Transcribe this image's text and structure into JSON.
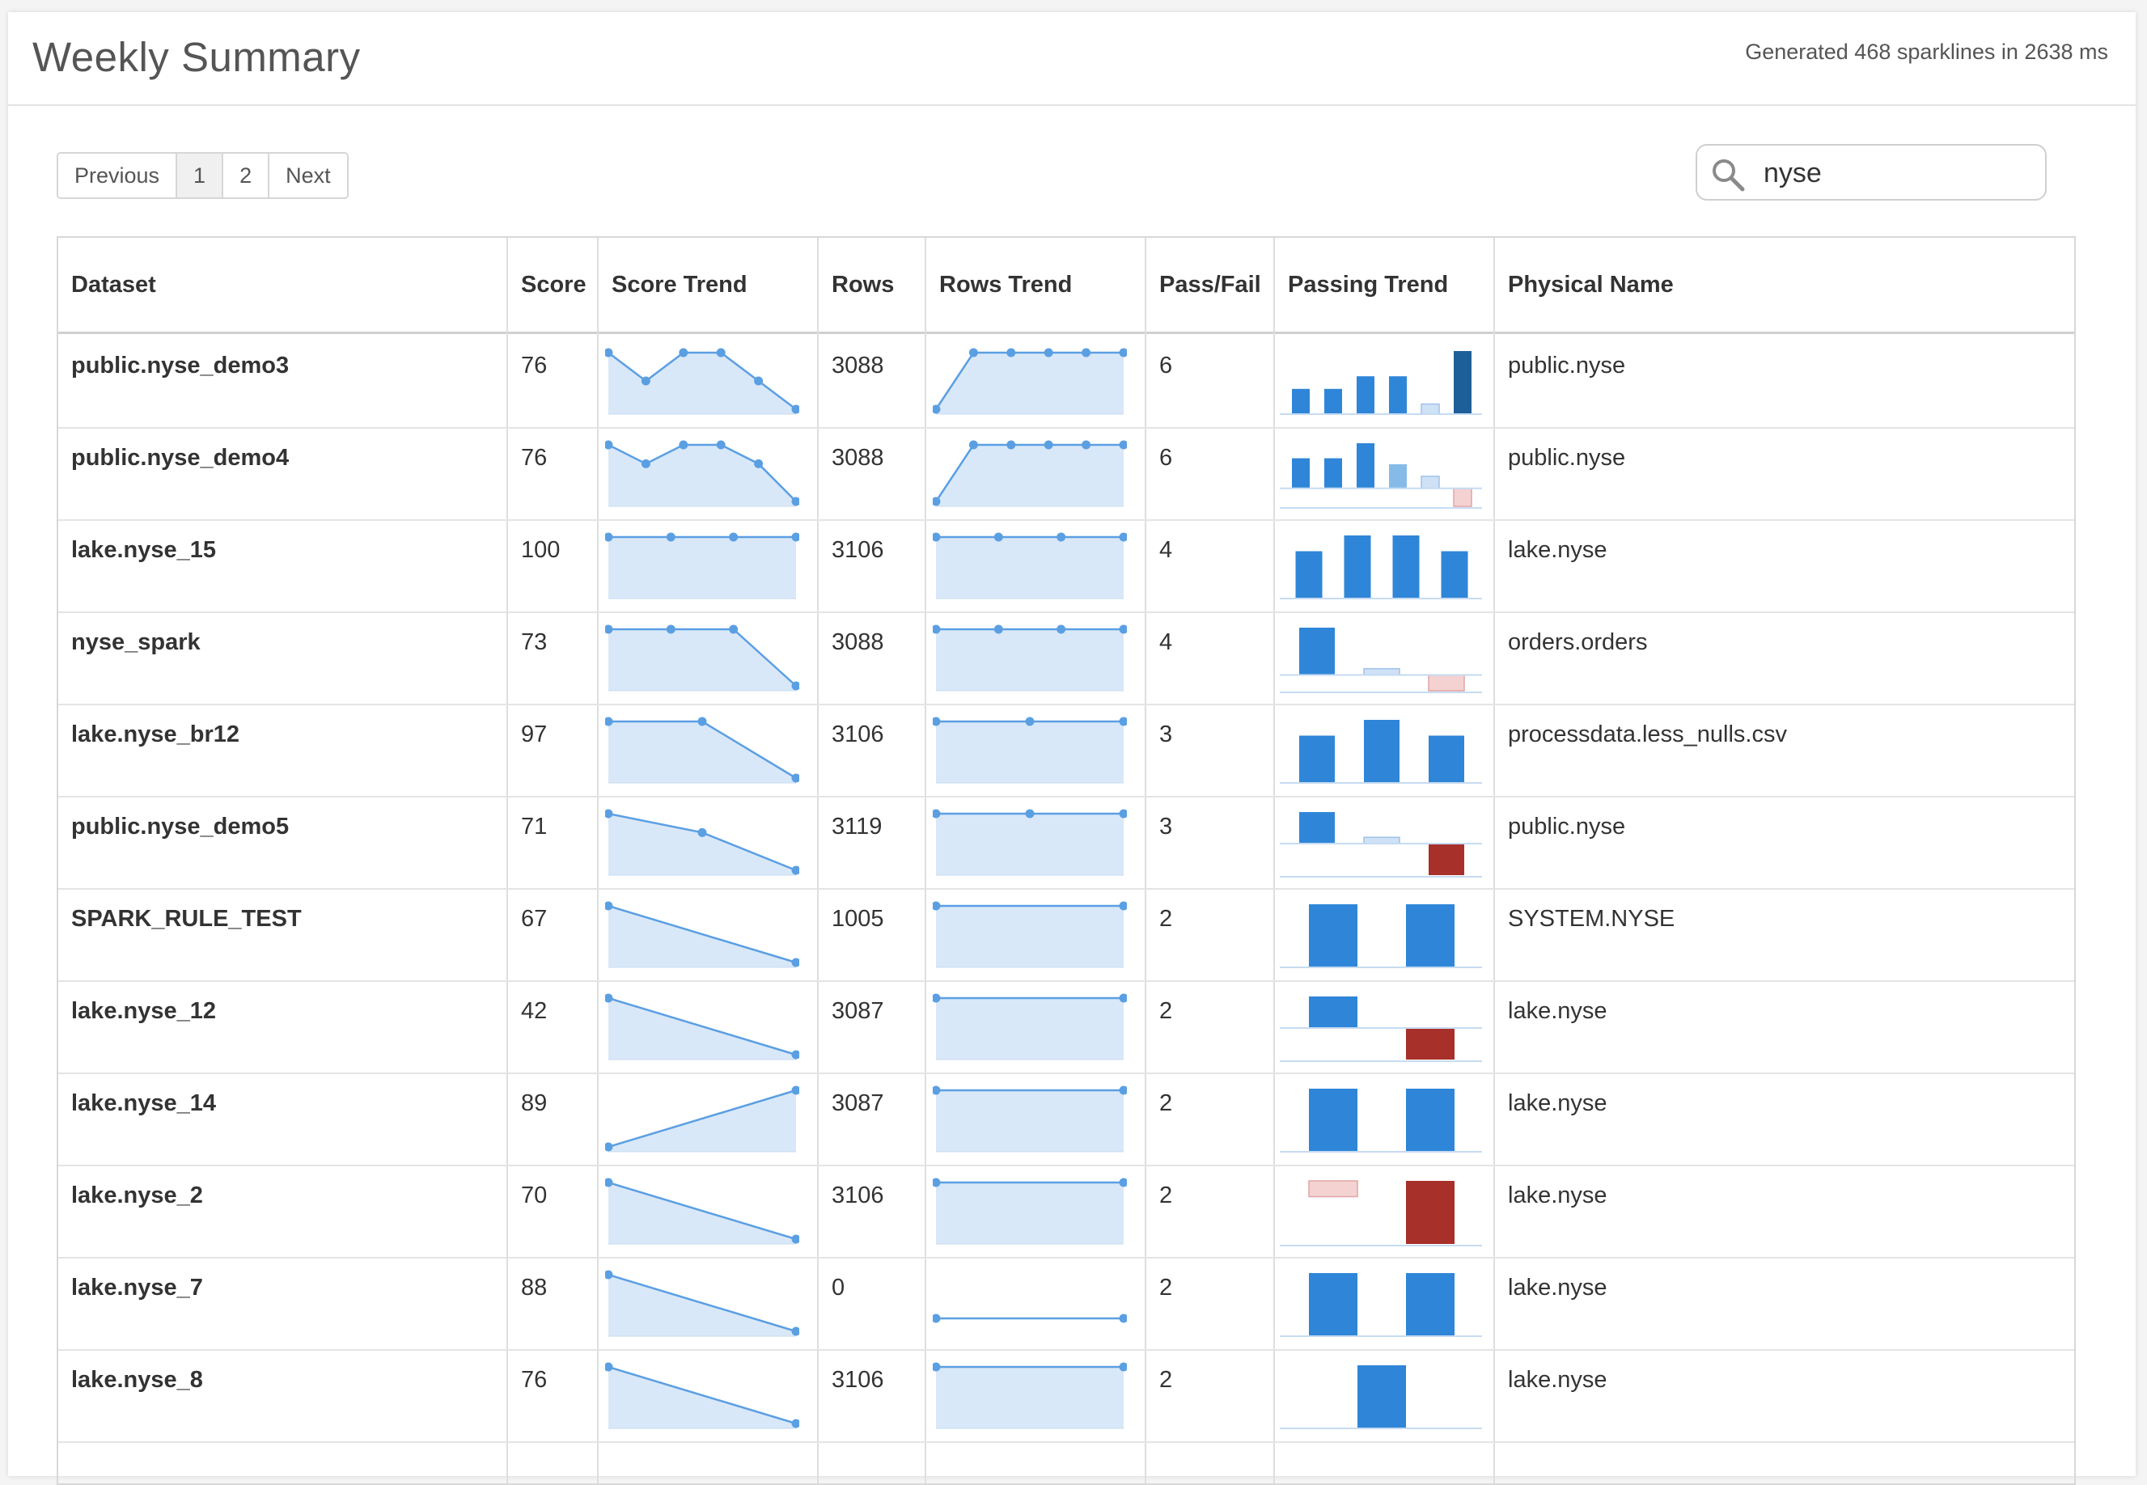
{
  "header": {
    "title": "Weekly Summary",
    "generated": "Generated 468 sparklines in 2638 ms"
  },
  "pagination": {
    "previous": "Previous",
    "pages": [
      "1",
      "2"
    ],
    "next": "Next",
    "active_page": "1"
  },
  "search": {
    "value": "nyse",
    "icon": "search-icon"
  },
  "table": {
    "columns": [
      "Dataset",
      "Score",
      "Score Trend",
      "Rows",
      "Rows Trend",
      "Pass/Fail",
      "Passing Trend",
      "Physical Name"
    ],
    "rows": [
      {
        "dataset": "public.nyse_demo3",
        "score": "76",
        "score_trend": [
          78,
          76,
          78,
          78,
          76,
          74
        ],
        "rows": "3088",
        "rows_trend": [
          0,
          3088,
          3088,
          3088,
          3088,
          3088
        ],
        "pass_fail": "6",
        "passing_trend": [
          2,
          2,
          3,
          3,
          0.8,
          5
        ],
        "passing_colors": [
          "#2f86d8",
          "#2f86d8",
          "#2f86d8",
          "#2f86d8",
          "#cfe1f5",
          "#1f5f99"
        ],
        "physical_name": "public.nyse"
      },
      {
        "dataset": "public.nyse_demo4",
        "score": "76",
        "score_trend": [
          78,
          76,
          78,
          78,
          76,
          72
        ],
        "rows": "3088",
        "rows_trend": [
          0,
          3088,
          3088,
          3088,
          3088,
          3088
        ],
        "pass_fail": "6",
        "passing_trend": [
          2,
          2,
          3,
          1.6,
          0.8,
          -1.2
        ],
        "passing_colors": [
          "#2f86d8",
          "#2f86d8",
          "#2f86d8",
          "#86bbe8",
          "#cfe1f5",
          "#f4d2d2"
        ],
        "physical_name": "public.nyse"
      },
      {
        "dataset": "lake.nyse_15",
        "score": "100",
        "score_trend": [
          100,
          100,
          100,
          100
        ],
        "rows": "3106",
        "rows_trend": [
          3106,
          3106,
          3106,
          3106
        ],
        "pass_fail": "4",
        "passing_trend": [
          3,
          4,
          4,
          3
        ],
        "passing_colors": [
          "#2f86d8",
          "#2f86d8",
          "#2f86d8",
          "#2f86d8"
        ],
        "physical_name": "lake.nyse"
      },
      {
        "dataset": "nyse_spark",
        "score": "73",
        "score_trend": [
          76,
          76,
          76,
          73
        ],
        "rows": "3088",
        "rows_trend": [
          3088,
          3088,
          3088,
          3088
        ],
        "pass_fail": "4",
        "passing_trend": [
          3,
          0.4,
          -1
        ],
        "passing_colors": [
          "#2f86d8",
          "#cfe1f5",
          "#f4d2d2"
        ],
        "physical_name": "orders.orders"
      },
      {
        "dataset": "lake.nyse_br12",
        "score": "97",
        "score_trend": [
          97,
          97,
          96.8
        ],
        "rows": "3106",
        "rows_trend": [
          3106,
          3106,
          3106
        ],
        "pass_fail": "3",
        "passing_trend": [
          3,
          4,
          3
        ],
        "passing_colors": [
          "#2f86d8",
          "#2f86d8",
          "#2f86d8"
        ],
        "physical_name": "processdata.less_nulls.csv"
      },
      {
        "dataset": "public.nyse_demo5",
        "score": "71",
        "score_trend": [
          74,
          73,
          71
        ],
        "rows": "3119",
        "rows_trend": [
          3119,
          3119,
          3119
        ],
        "pass_fail": "3",
        "passing_trend": [
          2,
          0.4,
          -2
        ],
        "passing_colors": [
          "#2f86d8",
          "#cfe1f5",
          "#a7302b"
        ],
        "physical_name": "public.nyse"
      },
      {
        "dataset": "SPARK_RULE_TEST",
        "score": "67",
        "score_trend": [
          67,
          66.5
        ],
        "rows": "1005",
        "rows_trend": [
          1005,
          1005
        ],
        "pass_fail": "2",
        "passing_trend": [
          4,
          4
        ],
        "passing_colors": [
          "#2f86d8",
          "#2f86d8"
        ],
        "physical_name": "SYSTEM.NYSE"
      },
      {
        "dataset": "lake.nyse_12",
        "score": "42",
        "score_trend": [
          46,
          40
        ],
        "rows": "3087",
        "rows_trend": [
          3087,
          3087
        ],
        "pass_fail": "2",
        "passing_trend": [
          2,
          -2
        ],
        "passing_colors": [
          "#2f86d8",
          "#a7302b"
        ],
        "physical_name": "lake.nyse"
      },
      {
        "dataset": "lake.nyse_14",
        "score": "89",
        "score_trend": [
          88,
          89
        ],
        "rows": "3087",
        "rows_trend": [
          3087,
          3087
        ],
        "pass_fail": "2",
        "passing_trend": [
          4,
          4
        ],
        "passing_colors": [
          "#2f86d8",
          "#2f86d8"
        ],
        "physical_name": "lake.nyse"
      },
      {
        "dataset": "lake.nyse_2",
        "score": "70",
        "score_trend": [
          71,
          70
        ],
        "rows": "3106",
        "rows_trend": [
          3106,
          3106
        ],
        "pass_fail": "2",
        "passing_trend": [
          -1,
          -4
        ],
        "passing_colors": [
          "#f4d2d2",
          "#a7302b"
        ],
        "physical_name": "lake.nyse"
      },
      {
        "dataset": "lake.nyse_7",
        "score": "88",
        "score_trend": [
          88,
          87.8
        ],
        "rows": "0",
        "rows_trend": [
          0,
          0
        ],
        "pass_fail": "2",
        "passing_trend": [
          4,
          4
        ],
        "passing_colors": [
          "#2f86d8",
          "#2f86d8"
        ],
        "physical_name": "lake.nyse"
      },
      {
        "dataset": "lake.nyse_8",
        "score": "76",
        "score_trend": [
          77,
          76
        ],
        "rows": "3106",
        "rows_trend": [
          3106,
          3106
        ],
        "pass_fail": "2",
        "passing_trend": [
          4
        ],
        "passing_colors": [
          "#2f86d8"
        ],
        "physical_name": "lake.nyse"
      }
    ]
  }
}
